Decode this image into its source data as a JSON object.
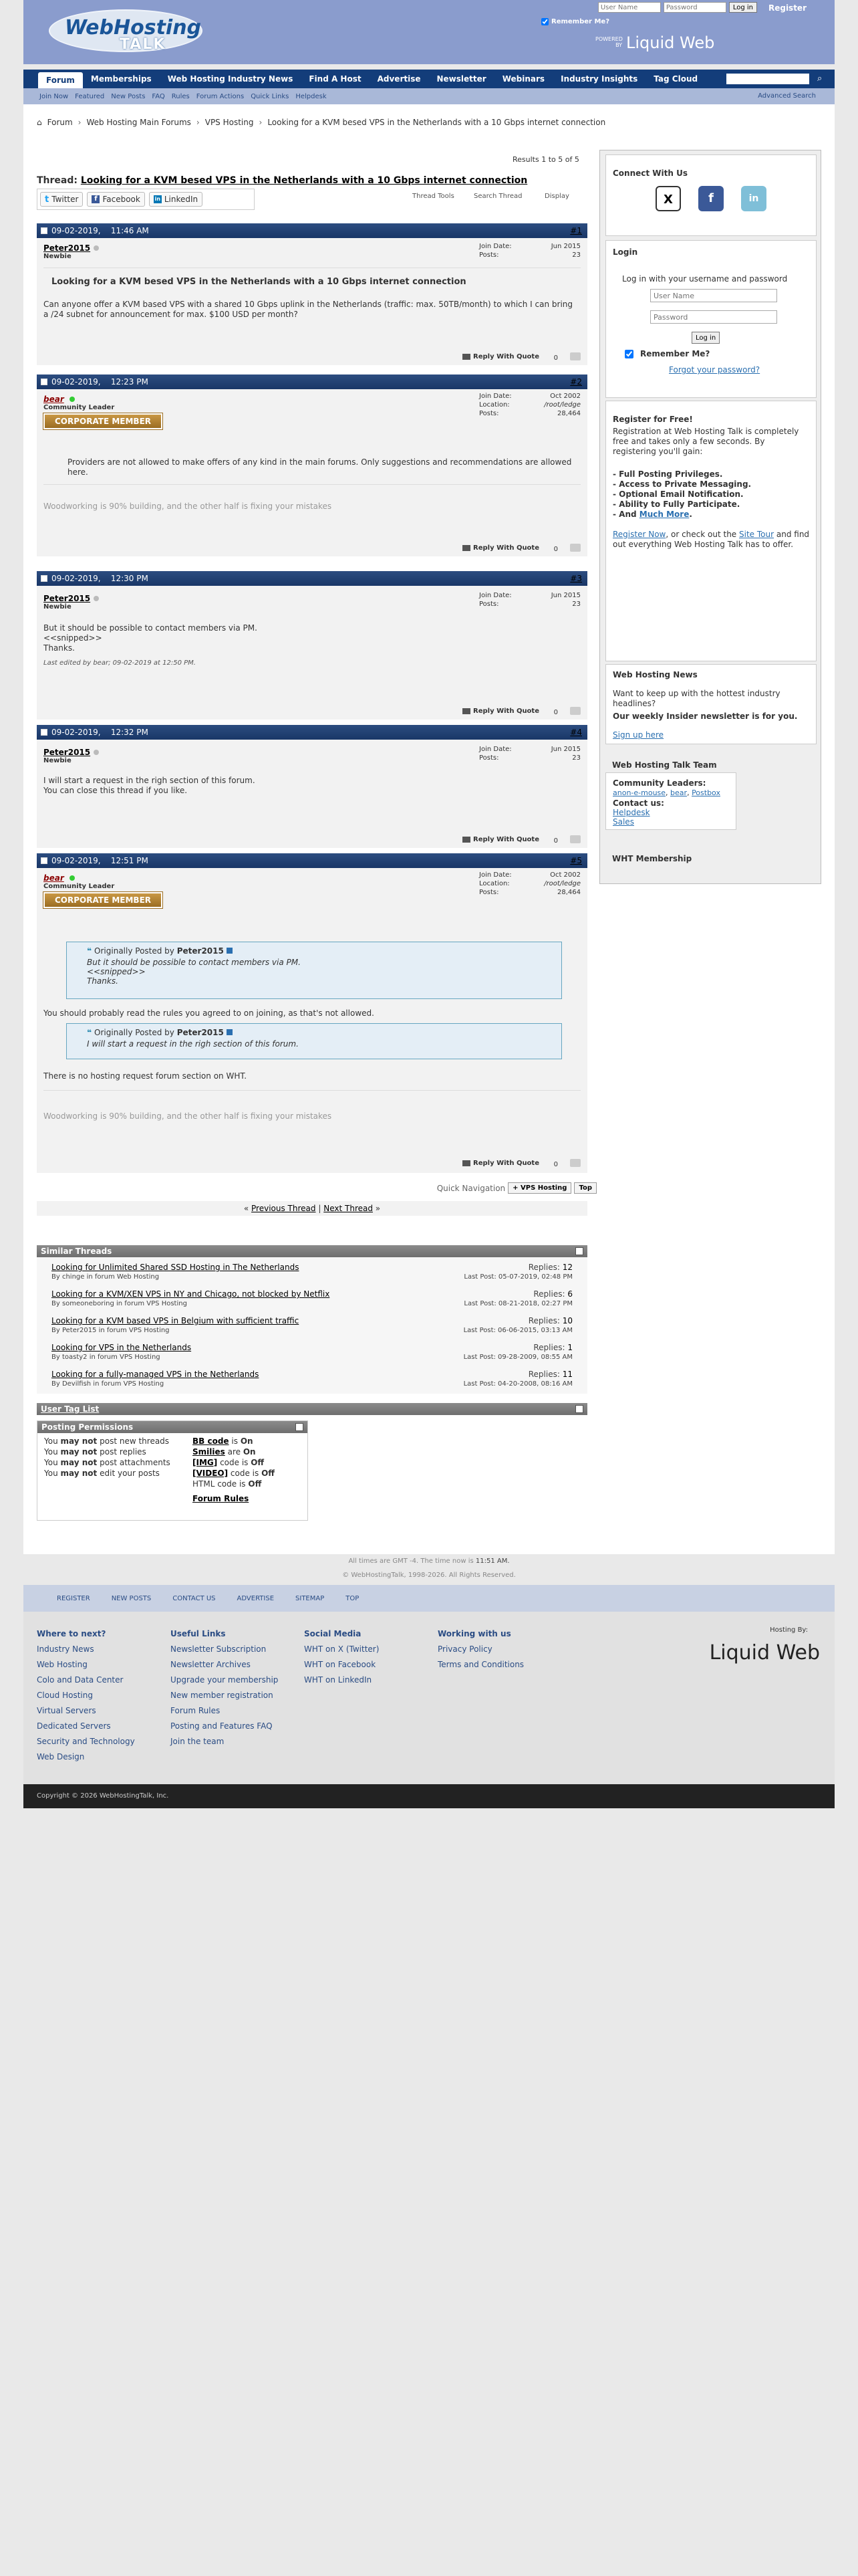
{
  "header": {
    "logo_line1": "WebHosting",
    "logo_line2": "TALK",
    "username_placeholder": "User Name",
    "password_placeholder": "Password",
    "login_button": "Log in",
    "register": "Register",
    "remember_me": "Remember Me?",
    "powered_by": "POWERED BY",
    "liquid_web": "Liquid Web"
  },
  "nav": {
    "items": [
      "Forum",
      "Memberships",
      "Web Hosting Industry News",
      "Find A Host",
      "Advertise",
      "Newsletter",
      "Webinars",
      "Industry Insights",
      "Tag Cloud"
    ],
    "search_icon": "search-icon"
  },
  "subnav": {
    "items": [
      "Join Now",
      "Featured",
      "New Posts",
      "FAQ",
      "Rules",
      "Forum Actions",
      "Quick Links",
      "Helpdesk"
    ],
    "advanced": "Advanced Search"
  },
  "breadcrumb": {
    "items": [
      "Forum",
      "Web Hosting Main Forums",
      "VPS Hosting",
      "Looking for a KVM besed VPS in the Netherlands with a 10 Gbps internet connection"
    ]
  },
  "results": "Results 1 to 5 of 5",
  "thread": {
    "prefix": "Thread:",
    "title": "Looking for a KVM besed VPS in the Netherlands with a 10 Gbps internet connection"
  },
  "share": {
    "twitter": "Twitter",
    "facebook": "Facebook",
    "linkedin": "LinkedIn"
  },
  "tools": {
    "thread_tools": "Thread Tools",
    "search_thread": "Search Thread",
    "display": "Display"
  },
  "posts": [
    {
      "date": "09-02-2019,",
      "time": "11:46 AM",
      "num": "#1",
      "user": "Peter2015",
      "title": "Newbie",
      "join_label": "Join Date:",
      "join": "Jun 2015",
      "posts_label": "Posts:",
      "posts": "23",
      "post_title": "Looking for a KVM besed VPS in the Netherlands with a 10 Gbps internet connection",
      "message": "Can anyone offer a KVM based VPS with a shared 10 Gbps uplink in the Netherlands (traffic: max. 50TB/month) to which I can bring a /24 subnet for announcement for max. $100 USD per month?"
    },
    {
      "date": "09-02-2019,",
      "time": "12:23 PM",
      "num": "#2",
      "user": "bear",
      "title": "Community Leader",
      "badge": "CORPORATE MEMBER",
      "join_label": "Join Date:",
      "join": "Oct 2002",
      "loc_label": "Location:",
      "loc": "/root/ledge",
      "posts_label": "Posts:",
      "posts": "28,464",
      "message": "Providers are not allowed to make offers of any kind in the main forums. Only suggestions and recommendations are allowed here.",
      "sig": "Woodworking is 90% building, and the other half is fixing your mistakes"
    },
    {
      "date": "09-02-2019,",
      "time": "12:30 PM",
      "num": "#3",
      "user": "Peter2015",
      "title": "Newbie",
      "join_label": "Join Date:",
      "join": "Jun 2015",
      "posts_label": "Posts:",
      "posts": "23",
      "line1": "But it should be possible to contact members via PM.",
      "line2": "<<snipped>>",
      "line3": "Thanks.",
      "edited": "Last edited by bear; 09-02-2019 at 12:50 PM."
    },
    {
      "date": "09-02-2019,",
      "time": "12:32 PM",
      "num": "#4",
      "user": "Peter2015",
      "title": "Newbie",
      "join_label": "Join Date:",
      "join": "Jun 2015",
      "posts_label": "Posts:",
      "posts": "23",
      "line1": "I will start a request in the righ section of this forum.",
      "line2": "You can close this thread if you like."
    },
    {
      "date": "09-02-2019,",
      "time": "12:51 PM",
      "num": "#5",
      "user": "bear",
      "title": "Community Leader",
      "badge": "CORPORATE MEMBER",
      "join_label": "Join Date:",
      "join": "Oct 2002",
      "loc_label": "Location:",
      "loc": "/root/ledge",
      "posts_label": "Posts:",
      "posts": "28,464",
      "q1_head": "Originally Posted by",
      "q1_user": "Peter2015",
      "q1_l1": "But it should be possible to contact members via PM.",
      "q1_l2": "<<snipped>>",
      "q1_l3": "Thanks.",
      "mid": "You should probably read the rules you agreed to on joining, as that's not allowed.",
      "q2_head": "Originally Posted by",
      "q2_user": "Peter2015",
      "q2_l1": "I will start a request in the righ section of this forum.",
      "end": "There is no hosting request forum section on WHT.",
      "sig": "Woodworking is 90% building, and the other half is fixing your mistakes"
    }
  ],
  "reply_with_quote": "Reply With Quote",
  "zero": "0",
  "quick_nav": {
    "label": "Quick Navigation",
    "current": "VPS Hosting",
    "top": "Top"
  },
  "prevnext": {
    "prev": "Previous Thread",
    "sep": "|",
    "next": "Next Thread",
    "lq": "«",
    "rq": "»"
  },
  "similar": {
    "heading": "Similar Threads",
    "rows": [
      {
        "title": "Looking for Unlimited Shared SSD Hosting in The Netherlands",
        "by": "By chinge in forum Web Hosting",
        "replies_label": "Replies:",
        "replies": "12",
        "last": "Last Post: 05-07-2019, 02:48 PM"
      },
      {
        "title": "Looking for a KVM/XEN VPS in NY and Chicago, not blocked by Netflix",
        "by": "By someoneboring in forum VPS Hosting",
        "replies_label": "Replies:",
        "replies": "6",
        "last": "Last Post: 08-21-2018, 02:27 PM"
      },
      {
        "title": "Looking for a KVM based VPS in Belgium with sufficient traffic",
        "by": "By Peter2015 in forum VPS Hosting",
        "replies_label": "Replies:",
        "replies": "10",
        "last": "Last Post: 06-06-2015, 03:13 AM"
      },
      {
        "title": "Looking for VPS in the Netherlands",
        "by": "By toasty2 in forum VPS Hosting",
        "replies_label": "Replies:",
        "replies": "1",
        "last": "Last Post: 09-28-2009, 08:55 AM"
      },
      {
        "title": "Looking for a fully-managed VPS in the Netherlands",
        "by": "By Devilfish in forum VPS Hosting",
        "replies_label": "Replies:",
        "replies": "11",
        "last": "Last Post: 04-20-2008, 08:16 AM"
      }
    ]
  },
  "tag_list": {
    "heading": "User Tag List"
  },
  "permissions": {
    "heading": "Posting Permissions",
    "you": "You",
    "may_not": "may not",
    "l1": "post new threads",
    "l2": "post replies",
    "l3": "post attachments",
    "l4": "edit your posts",
    "bb": "BB code",
    "is": "is",
    "on": "On",
    "smilies": "Smilies",
    "are": "are",
    "img": "[IMG]",
    "code_is": "code is",
    "off": "Off",
    "video": "[VIDEO]",
    "html": "HTML code is",
    "rules": "Forum Rules"
  },
  "sidebar": {
    "connect": "Connect With Us",
    "x_icon": "x-icon",
    "login": "Login",
    "login_text": "Log in with your username and password",
    "username": "User Name",
    "password": "Password",
    "login_btn": "Log in",
    "remember": "Remember Me?",
    "forgot": "Forgot your password?",
    "register_title": "Register for Free!",
    "register_text": "Registration at Web Hosting Talk is completely free and takes only a few seconds. By registering you'll gain:",
    "b1": "- Full Posting Privileges.",
    "b2": "- Access to Private Messaging.",
    "b3": "- Optional Email Notification.",
    "b4": "- Ability to Fully Participate.",
    "b5": "- And",
    "much_more": "Much More",
    "reg_now": "Register Now",
    "reg_mid": ", or check out the",
    "site_tour": "Site Tour",
    "reg_end": "and find out everything Web Hosting Talk has to offer.",
    "news_title": "Web Hosting News",
    "news_text": "Want to keep up with the hottest industry headlines?",
    "newsletter": "Our weekly Insider newsletter is for you.",
    "signup": "Sign up here",
    "team_title": "Web Hosting Talk Team",
    "leaders": "Community Leaders:",
    "l1": "anon-e-mouse",
    "l2": "bear",
    "l3": "Postbox",
    "contact": "Contact us:",
    "helpdesk": "Helpdesk",
    "sales": "Sales",
    "membership": "WHT Membership"
  },
  "footer": {
    "time_text": "All times are GMT -4. The time now is",
    "time": "11:51 AM.",
    "copy": "© WebHostingTalk, 1998-2026. All Rights Reserved.",
    "links": [
      "REGISTER",
      "NEW POSTS",
      "CONTACT US",
      "ADVERTISE",
      "SITEMAP",
      "TOP"
    ],
    "col1": {
      "h": "Where to next?",
      "items": [
        "Industry News",
        "Web Hosting",
        "Colo and Data Center",
        "Cloud Hosting",
        "Virtual Servers",
        "Dedicated Servers",
        "Security and Technology",
        "Web Design"
      ]
    },
    "col2": {
      "h": "Useful Links",
      "items": [
        "Newsletter Subscription",
        "Newsletter Archives",
        "Upgrade your membership",
        "New member registration",
        "Forum Rules",
        "Posting and Features FAQ",
        "Join the team"
      ]
    },
    "col3": {
      "h": "Social Media",
      "items": [
        "WHT on X (Twitter)",
        "WHT on Facebook",
        "WHT on LinkedIn"
      ]
    },
    "col4": {
      "h": "Working with us",
      "items": [
        "Privacy Policy",
        "Terms and Conditions"
      ]
    },
    "hosted": "Hosting By:",
    "liquid": "Liquid Web",
    "copyright": "Copyright © 2026 WebHostingTalk, Inc."
  },
  "colors": {
    "nav": "#133d7a",
    "header": "#8a9ccd",
    "post_head": "#193767",
    "badge": "#b5843a"
  }
}
